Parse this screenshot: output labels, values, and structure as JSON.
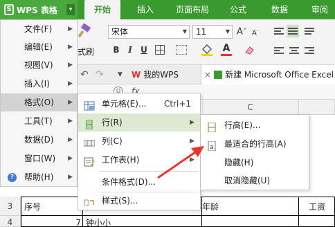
{
  "app": {
    "title": "WPS 表格",
    "logo_letter": "S",
    "menu_caret": "▾"
  },
  "ribbon_tabs": [
    {
      "label": "开始"
    },
    {
      "label": "插入"
    },
    {
      "label": "页面布局"
    },
    {
      "label": "公式"
    },
    {
      "label": "数据"
    },
    {
      "label": "审阅"
    }
  ],
  "ribbon": {
    "format_painter_label": "式刷",
    "font_name": "宋体",
    "font_size": "11",
    "bold": "B",
    "italic": "I",
    "underline": "U",
    "font_color_label": "A"
  },
  "doc_tabs": {
    "wps_icon": "W",
    "wps_label": "我的WPS",
    "close_glyph": "×",
    "excel_label": "新建 Microsoft Office Excel 工"
  },
  "formula_bar": {
    "fx_label": "fx"
  },
  "main_menu": [
    {
      "label": "文件(F)"
    },
    {
      "label": "编辑(E)"
    },
    {
      "label": "视图(V)"
    },
    {
      "label": "插入(I)"
    },
    {
      "label": "格式(O)"
    },
    {
      "label": "工具(T)"
    },
    {
      "label": "数据(D)"
    },
    {
      "label": "窗口(W)"
    },
    {
      "label": "帮助(H)"
    }
  ],
  "submenu_arrow": "▶",
  "format_menu": [
    {
      "label": "单元格(E)...",
      "shortcut": "Ctrl+1"
    },
    {
      "label": "行(R)"
    },
    {
      "label": "列(C)"
    },
    {
      "label": "工作表(H)"
    },
    {
      "label": "条件格式(D)..."
    },
    {
      "label": "样式(S)..."
    }
  ],
  "row_menu": [
    {
      "label": "行高(E)..."
    },
    {
      "label": "最适合的行高(A)"
    },
    {
      "label": "隐藏(H)"
    },
    {
      "label": "取消隐藏(U)"
    }
  ],
  "sheet": {
    "column_c": "C",
    "row_numbers": [
      "3",
      "4"
    ],
    "row3": {
      "a": "序号",
      "c": "年龄",
      "d": "工资"
    },
    "row4": {
      "a": "7",
      "b": "钟小小"
    }
  },
  "help_glyph": "?",
  "accent_color": "#3a9a2f",
  "annotation_arrow_color": "#e8372c"
}
